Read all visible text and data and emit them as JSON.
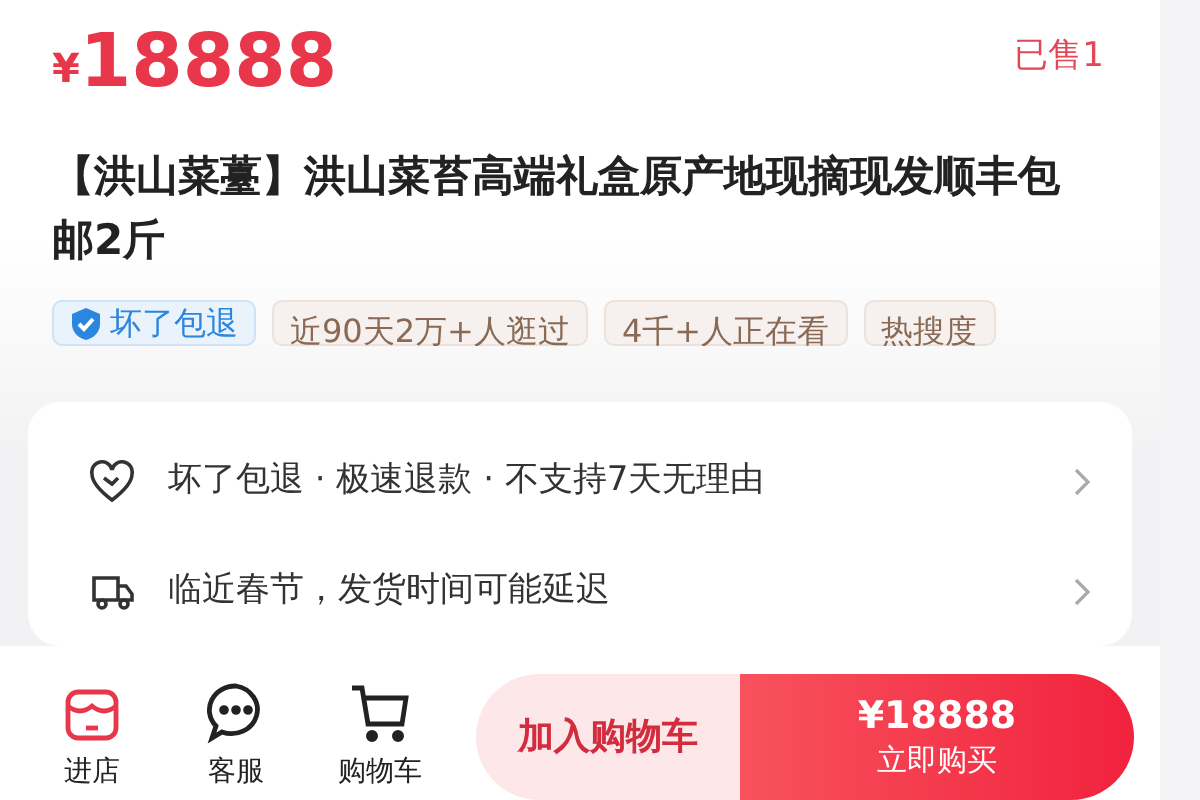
{
  "price": {
    "currency": "¥",
    "amount": "18888"
  },
  "sold": "已售1",
  "title": "【洪山菜薹】洪山菜苔高端礼盒原产地现摘现发顺丰包邮2斤",
  "tags": [
    {
      "kind": "guarantee",
      "label": "坏了包退"
    },
    {
      "kind": "plain",
      "label": "近90天2万+人逛过"
    },
    {
      "kind": "plain",
      "label": "4千+人正在看"
    },
    {
      "kind": "plain",
      "label": "热搜度"
    }
  ],
  "service_rows": [
    {
      "kind": "heart",
      "text": "坏了包退 · 极速退款 · 不支持7天无理由"
    },
    {
      "kind": "truck",
      "text": "临近春节，发货时间可能延迟"
    }
  ],
  "bottom_bar": {
    "actions": [
      {
        "kind": "store",
        "label": "进店"
      },
      {
        "kind": "chat",
        "label": "客服"
      },
      {
        "kind": "cart",
        "label": "购物车"
      }
    ],
    "add_to_cart": "加入购物车",
    "buy": {
      "price": "¥18888",
      "label": "立即购买"
    }
  }
}
